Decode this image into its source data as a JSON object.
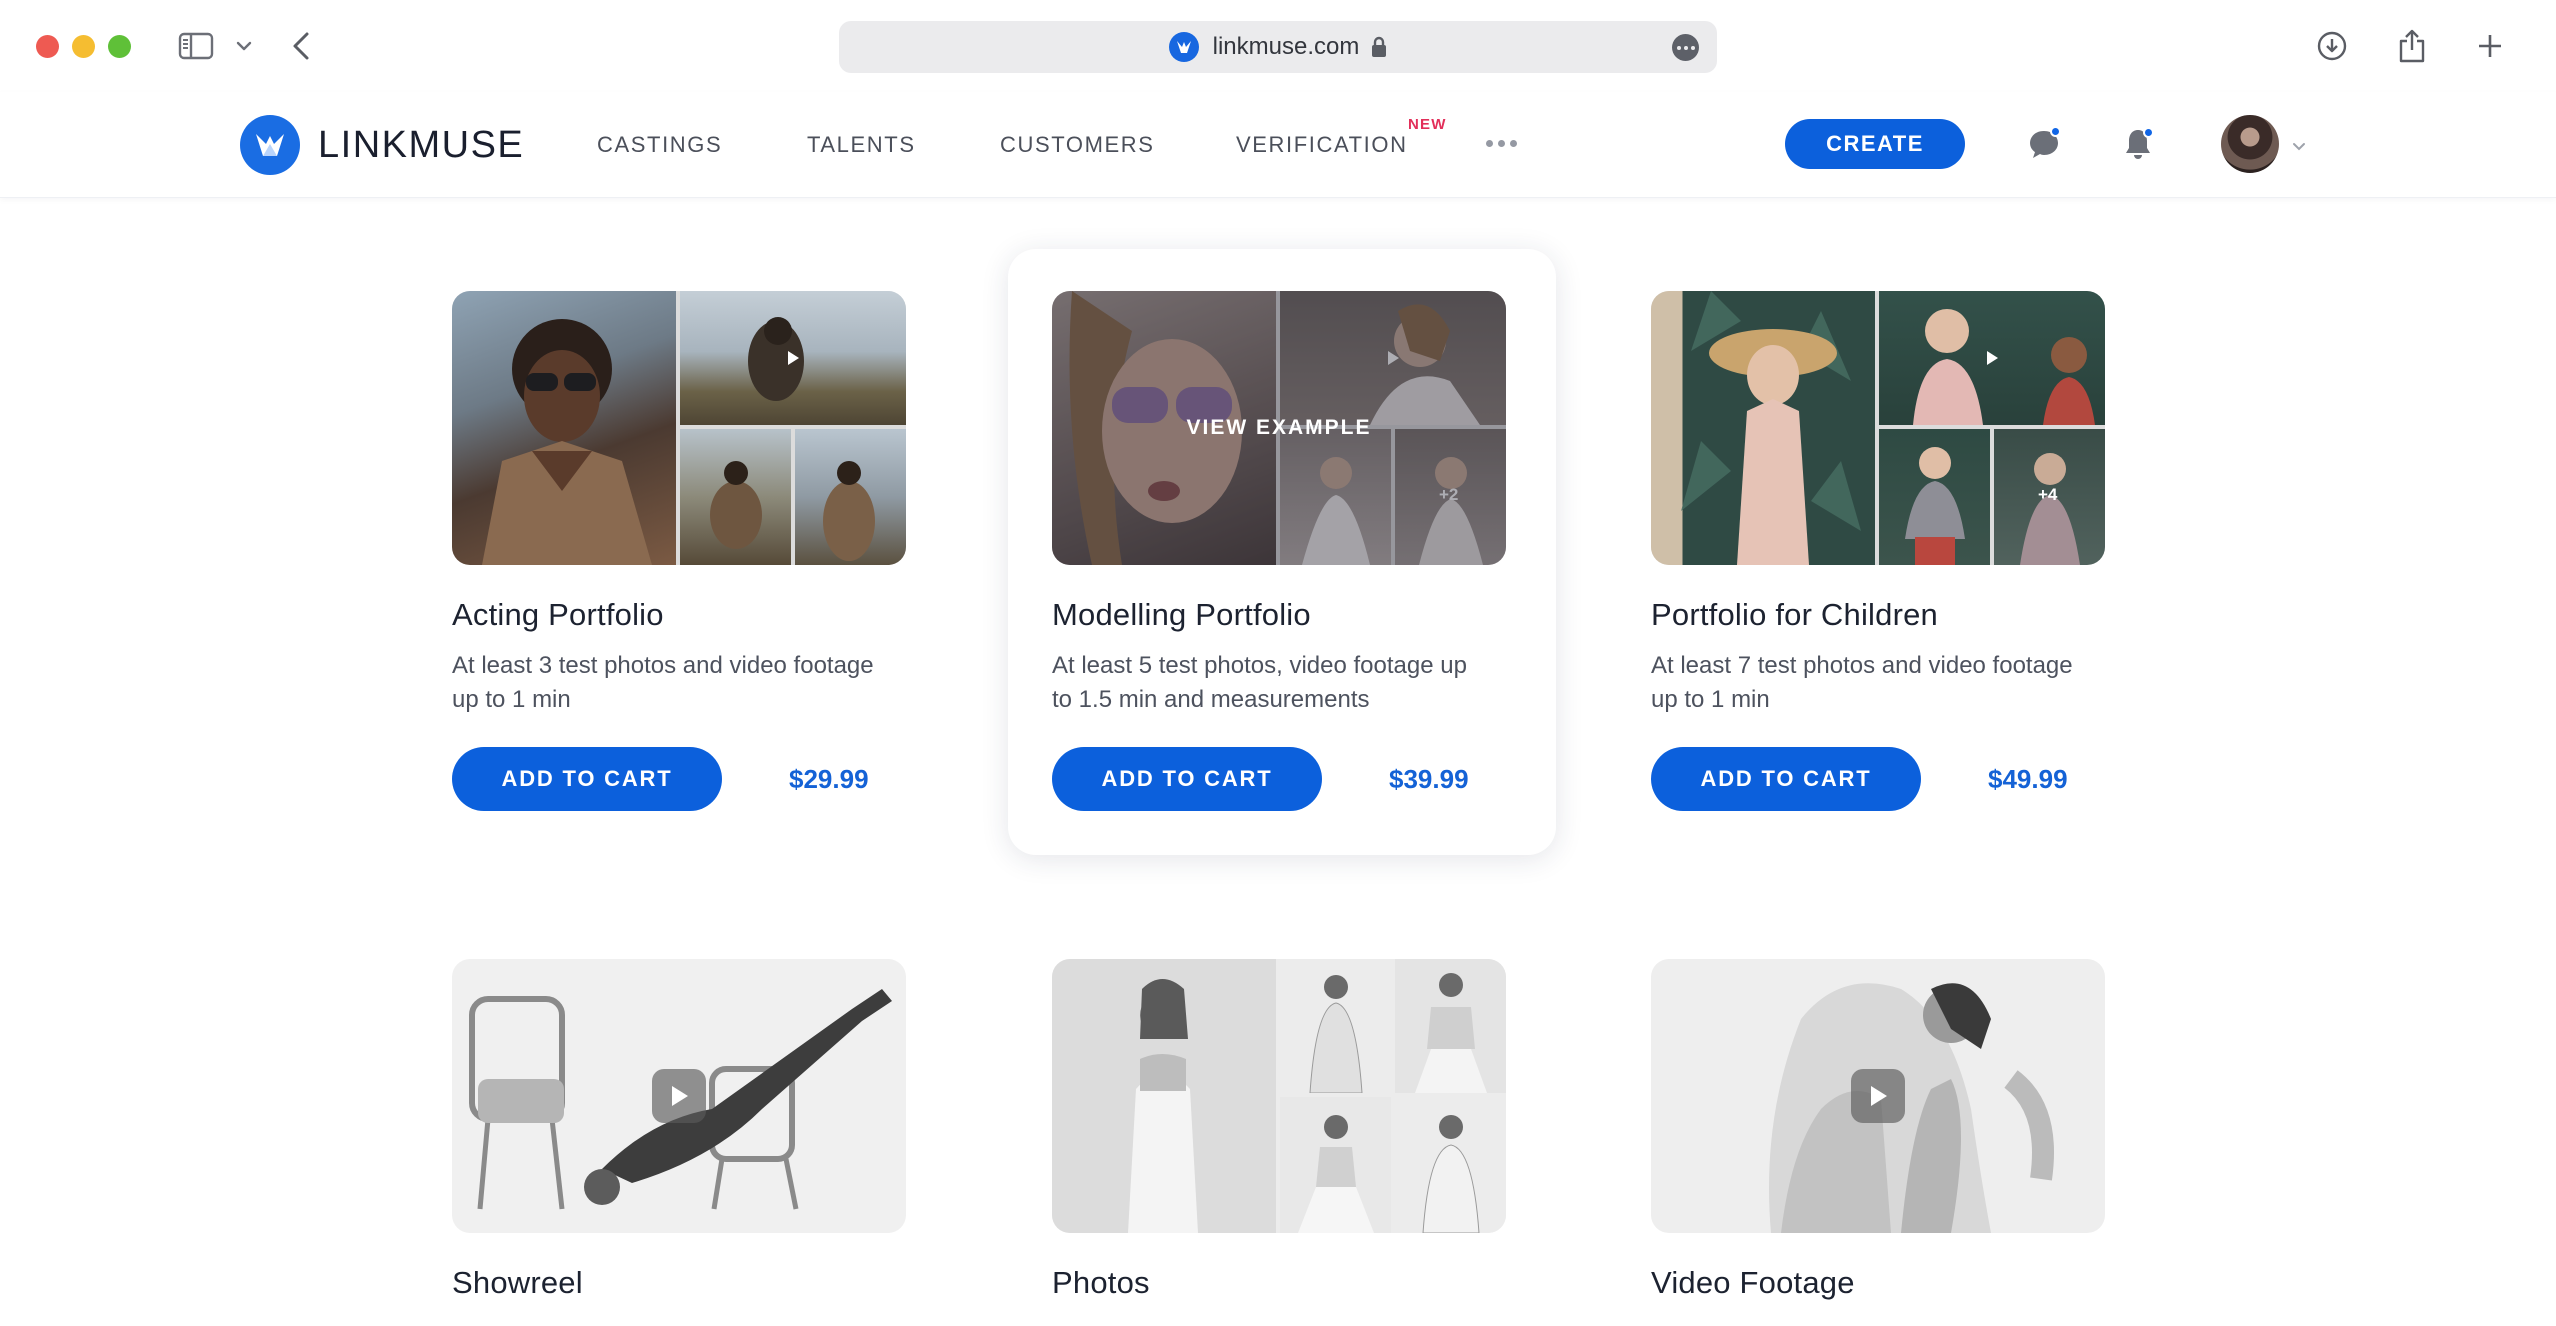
{
  "browser": {
    "url": "linkmuse.com"
  },
  "nav": {
    "brand": "LINKMUSE",
    "links": [
      "CASTINGS",
      "TALENTS",
      "CUSTOMERS",
      "VERIFICATION"
    ],
    "new_badge": "NEW",
    "create_label": "CREATE"
  },
  "colors": {
    "accent": "#0c60dc",
    "badge": "#e22f5a",
    "price": "#1462d6"
  },
  "cards": [
    {
      "title": "Acting Portfolio",
      "description": "At least 3 test photos and video footage up to 1 min",
      "cta": "ADD TO CART",
      "price": "$29.99"
    },
    {
      "title": "Modelling Portfolio",
      "description": "At least 5 test photos, video footage up to 1.5 min and measurements",
      "cta": "ADD TO CART",
      "price": "$39.99",
      "overlay_label": "VIEW EXAMPLE",
      "more_count": "+2"
    },
    {
      "title": "Portfolio for Children",
      "description": "At least 7 test photos and video footage up to 1 min",
      "cta": "ADD TO CART",
      "price": "$49.99",
      "more_count": "+4"
    },
    {
      "title": "Showreel"
    },
    {
      "title": "Photos"
    },
    {
      "title": "Video Footage"
    }
  ]
}
